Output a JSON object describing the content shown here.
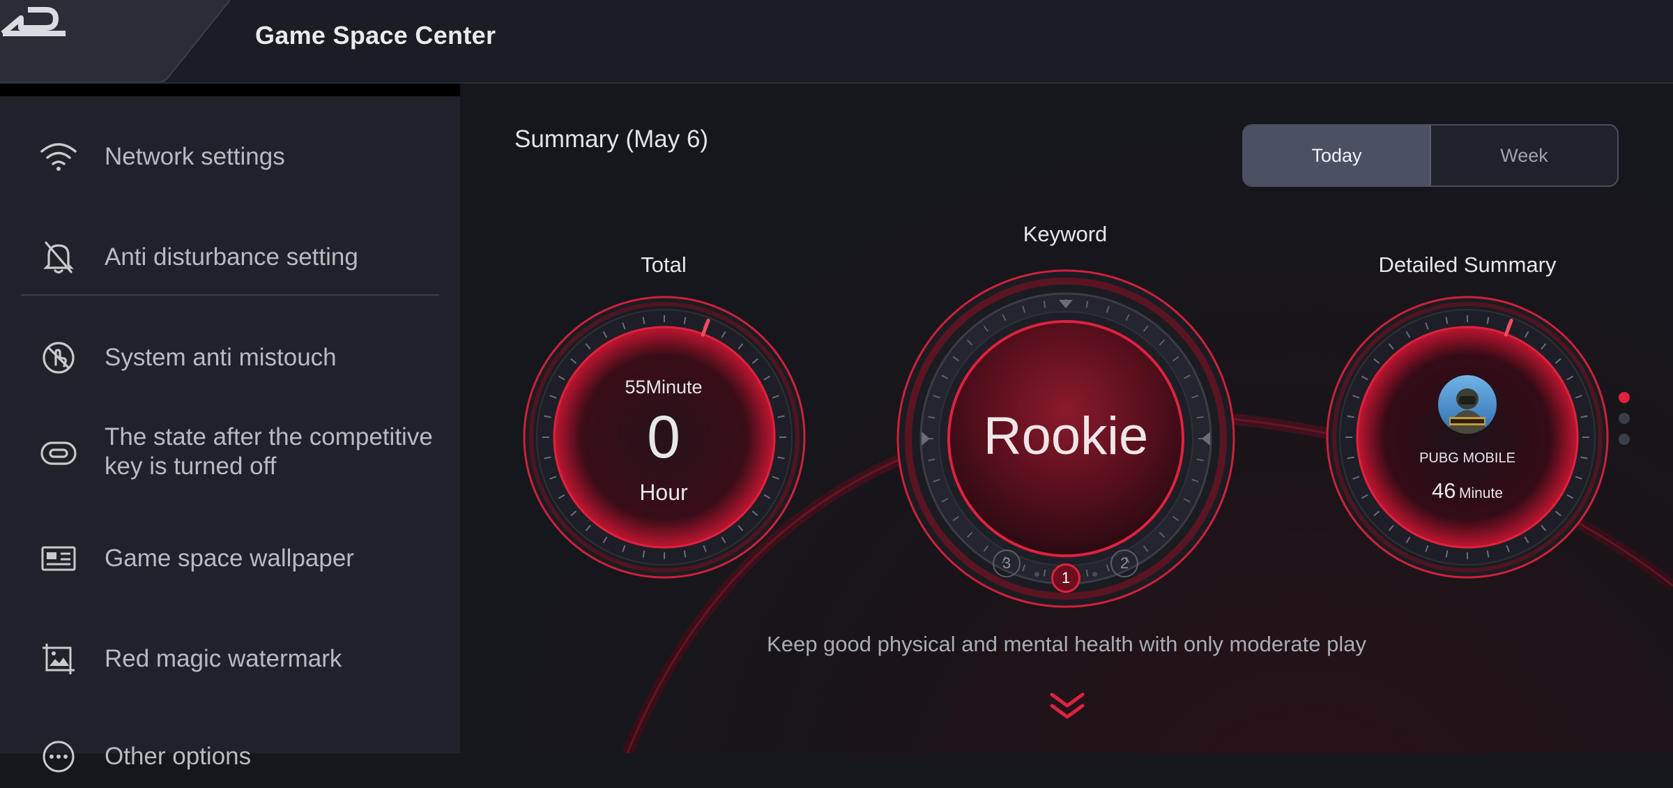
{
  "header": {
    "title": "Game Space Center",
    "back_icon": "back-arrow-icon"
  },
  "sidebar": {
    "items": [
      {
        "label": "Network settings",
        "icon": "wifi-icon"
      },
      {
        "label": "Anti disturbance setting",
        "icon": "bell-off-icon"
      },
      {
        "label": "System anti mistouch",
        "icon": "no-touch-icon"
      },
      {
        "label": "The state after the competitive key is turned off",
        "icon": "toggle-key-icon"
      },
      {
        "label": "Game space wallpaper",
        "icon": "wallpaper-icon"
      },
      {
        "label": "Red magic watermark",
        "icon": "image-watermark-icon"
      },
      {
        "label": "Other options",
        "icon": "more-options-icon"
      }
    ]
  },
  "main": {
    "summary_title": "Summary (May 6)",
    "tabs": [
      {
        "label": "Today",
        "selected": true
      },
      {
        "label": "Week",
        "selected": false
      }
    ],
    "total": {
      "label": "Total",
      "minutes_text": "55Minute",
      "hours_value": "0",
      "hours_unit": "Hour"
    },
    "keyword": {
      "label": "Keyword",
      "value": "Rookie",
      "pages": [
        "3",
        "1",
        "2"
      ],
      "current_page": "1"
    },
    "detailed": {
      "label": "Detailed Summary",
      "game_name": "PUBG MOBILE",
      "game_minutes": "46",
      "game_minutes_unit": "Minute",
      "pager_count": 3,
      "pager_active": 0
    },
    "motto": "Keep good physical and mental health with only moderate play",
    "expand_icon": "double-chevron-down-icon"
  },
  "colors": {
    "accent": "#e0213f",
    "sidebar_bg": "#20222a",
    "main_bg": "#15171d",
    "tab_selected": "#4b5163"
  }
}
